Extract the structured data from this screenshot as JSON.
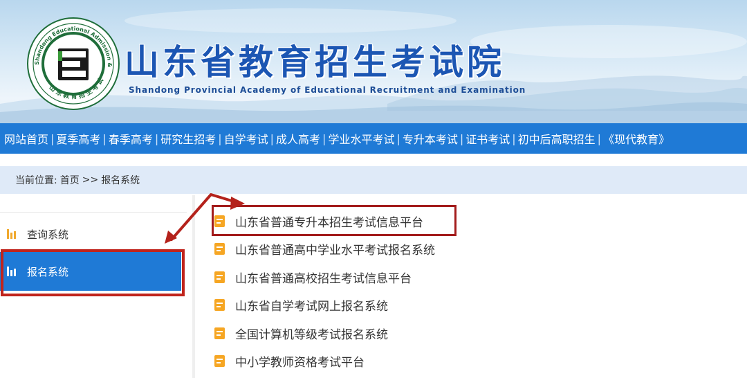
{
  "header": {
    "title": "山东省教育招生考试院",
    "subtitle": "Shandong Provincial Academy of Educational Recruitment and Examination",
    "logo": {
      "ring_text_en": "Shandong Educational Admission & Examinations",
      "ring_text_cn": "山东教育招生考试",
      "letter": "E"
    }
  },
  "nav": {
    "items": [
      "网站首页",
      "夏季高考",
      "春季高考",
      "研究生招考",
      "自学考试",
      "成人高考",
      "学业水平考试",
      "专升本考试",
      "证书考试",
      "初中后高职招生",
      "《现代教育》"
    ],
    "separator": "|"
  },
  "breadcrumb": {
    "label": "当前位置:",
    "home": "首页",
    "sep": ">>",
    "current": "报名系统"
  },
  "sidebar": {
    "items": [
      {
        "label": "查询系统",
        "active": false
      },
      {
        "label": "报名系统",
        "active": true
      }
    ]
  },
  "links": {
    "items": [
      "山东省普通专升本招生考试信息平台",
      "山东省普通高中学业水平考试报名系统",
      "山东省普通高校招生考试信息平台",
      "山东省自学考试网上报名系统",
      "全国计算机等级考试报名系统",
      "中小学教师资格考试平台"
    ]
  },
  "colors": {
    "brand_blue": "#1f7ad6",
    "title_blue": "#1c56b3",
    "highlight_red": "#c0241c",
    "icon_orange": "#f6a623",
    "breadcrumb_bg": "#dfeaf8"
  }
}
